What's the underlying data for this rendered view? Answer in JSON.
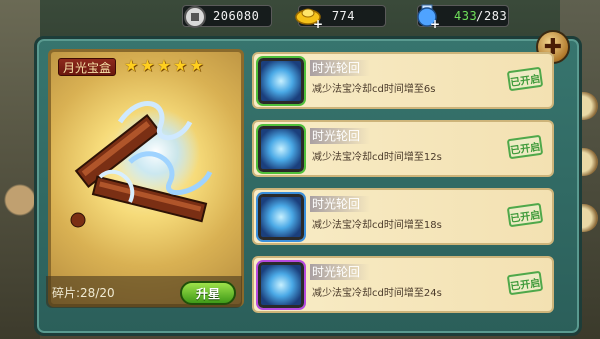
{
  "resources": {
    "coins": "206080",
    "gold": "774",
    "energy_current": "433",
    "energy_sep": "/",
    "energy_max": "283"
  },
  "treasure": {
    "name": "月光宝盒",
    "stars": 5,
    "star_glyph": "★",
    "fragments_label": "碎片:28/20",
    "upgrade_label": "升星"
  },
  "close_label": "✚",
  "skills": [
    {
      "title": "时光轮回",
      "desc": "减少法宝冷却cd时间增至6s",
      "status": "已开启",
      "frame": "green"
    },
    {
      "title": "时光轮回",
      "desc": "减少法宝冷却cd时间增至12s",
      "status": "已开启",
      "frame": "green"
    },
    {
      "title": "时光轮回",
      "desc": "减少法宝冷却cd时间增至18s",
      "status": "已开启",
      "frame": "blue"
    },
    {
      "title": "时光轮回",
      "desc": "减少法宝冷却cd时间增至24s",
      "status": "已开启",
      "frame": "purple"
    }
  ],
  "colors": {
    "panel": "#2f6b65",
    "card_gold": "#f6db7a",
    "green_button": "#5cb82a",
    "status_green": "#3e9a3a"
  }
}
